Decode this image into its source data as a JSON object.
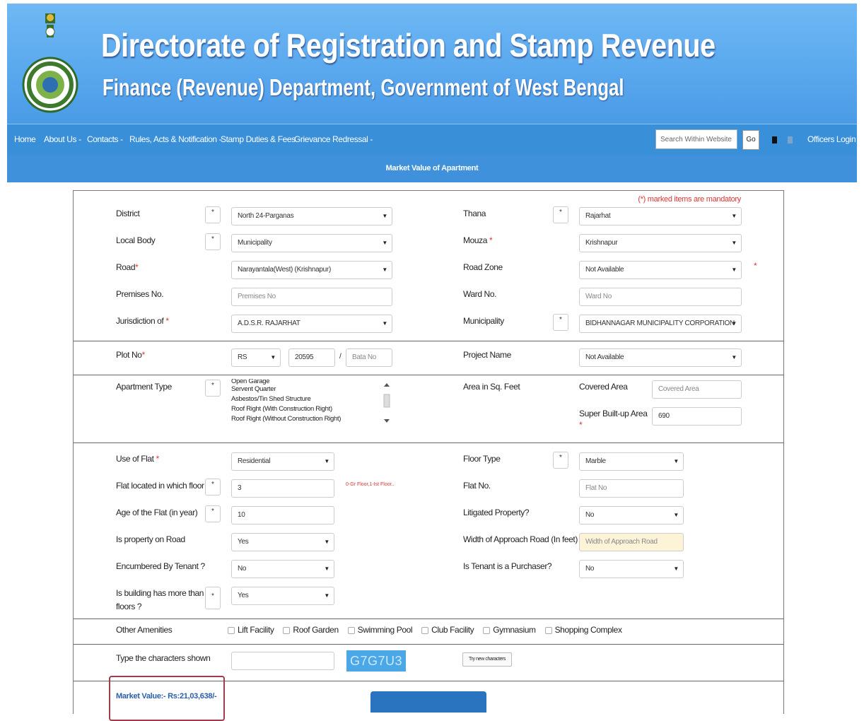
{
  "header": {
    "title": "Directorate of Registration and Stamp Revenue",
    "subtitle": "Finance (Revenue) Department, Government of West Bengal",
    "logo_icon": "west-bengal-emblem"
  },
  "nav": {
    "items": [
      "Home",
      "About Us -",
      "Contacts -",
      "Rules, Acts & Notification -",
      "Stamp Duties & Fees",
      "Grievance Redressal -"
    ],
    "search_placeholder": "Search Within Website",
    "go_label": "Go",
    "login_label": "Officers Login"
  },
  "page": {
    "heading": "Market Value of Apartment",
    "mandatory_note": "(*) marked items are mandatory"
  },
  "form": {
    "district": {
      "label": "District",
      "value": "North 24-Parganas"
    },
    "thana": {
      "label": "Thana",
      "value": "Rajarhat"
    },
    "local_body": {
      "label": "Local Body",
      "value": "Municipality"
    },
    "mouza": {
      "label": "Mouza",
      "value": "Krishnapur"
    },
    "road": {
      "label": "Road",
      "value": "Narayantala(West) (Krishnapur)"
    },
    "road_zone": {
      "label": "Road Zone",
      "value": "Not Available"
    },
    "premises": {
      "label": "Premises No.",
      "placeholder": "Premises No"
    },
    "ward": {
      "label": "Ward No.",
      "placeholder": "Ward No"
    },
    "jurisdiction": {
      "label": "Jurisdiction of",
      "value": "A.D.S.R. RAJARHAT"
    },
    "municipality": {
      "label": "Municipality",
      "value": "BIDHANNAGAR MUNICIPALITY CORPORATION"
    },
    "plot": {
      "label": "Plot No",
      "type_value": "RS",
      "number_value": "20595",
      "bata_placeholder": "Bata No"
    },
    "project": {
      "label": "Project Name",
      "value": "Not Available"
    },
    "apartment_type": {
      "label": "Apartment Type",
      "options": [
        "Open Garage",
        "Servent Quarter",
        "Asbestos/Tin Shed Structure",
        "Roof Right (With Construction Right)",
        "Roof Right (Without Construction Right)"
      ]
    },
    "area": {
      "label": "Area in Sq. Feet",
      "covered_label": "Covered Area",
      "covered_placeholder": "Covered Area",
      "super_label": "Super Built-up Area",
      "super_value": "690"
    },
    "use_of_flat": {
      "label": "Use of Flat",
      "value": "Residential"
    },
    "floor_type": {
      "label": "Floor Type",
      "value": "Marble"
    },
    "flat_floor": {
      "label": "Flat located in which floor",
      "value": "3",
      "hint": "0-Gr Floor,1-Ist Floor.."
    },
    "flat_no": {
      "label": "Flat No.",
      "placeholder": "Flat No"
    },
    "age": {
      "label": "Age of the Flat (in year)",
      "value": "10"
    },
    "litigated": {
      "label": "Litigated Property?",
      "value": "No"
    },
    "on_road": {
      "label": "Is property on Road",
      "value": "Yes"
    },
    "approach_width": {
      "label": "Width of Approach Road (In feet)",
      "placeholder": "Width of Approach Road"
    },
    "tenant": {
      "label": "Encumbered By Tenant ?",
      "value": "No"
    },
    "tenant_purchaser": {
      "label": "Is Tenant is a Purchaser?",
      "value": "No"
    },
    "more_floors": {
      "label_line1": "Is building has more than two",
      "label_line2": "floors ?",
      "value": "Yes"
    },
    "amenities": {
      "label": "Other Amenities",
      "items": [
        "Lift Facility",
        "Roof Garden",
        "Swimming Pool",
        "Club Facility",
        "Gymnasium",
        "Shopping Complex"
      ]
    },
    "captcha": {
      "label": "Type the characters shown",
      "code": "G7G7U3",
      "try_new": "Try new characters"
    },
    "market_value": "Market Value:- Rs:21,03,638/-",
    "info_marker": "*"
  },
  "colors": {
    "header_blue": "#5aa8ee",
    "nav_blue": "#3a8fd9",
    "required_red": "#d33",
    "result_blue": "#2a5ea8"
  }
}
